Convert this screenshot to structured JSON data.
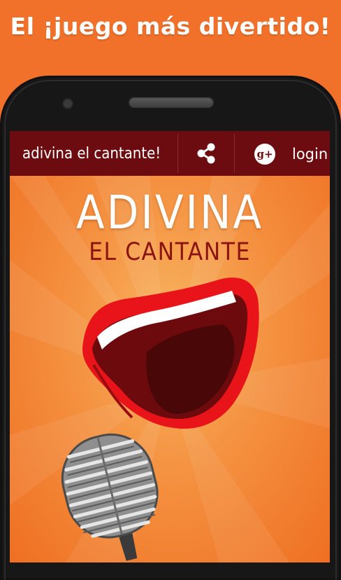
{
  "promo": {
    "headline": "El ¡juego más divertido!"
  },
  "toolbar": {
    "title": "adivina el cantante!",
    "share_icon": "share-icon",
    "gplus_icon": "google-plus-icon",
    "gplus_glyph": "g+",
    "login_label": "login"
  },
  "logo": {
    "line1": "ADIVINA",
    "line2": "EL CANTANTE"
  },
  "colors": {
    "background": "#f2712a",
    "toolbar": "#6d0c10",
    "accent": "#8a1414"
  }
}
